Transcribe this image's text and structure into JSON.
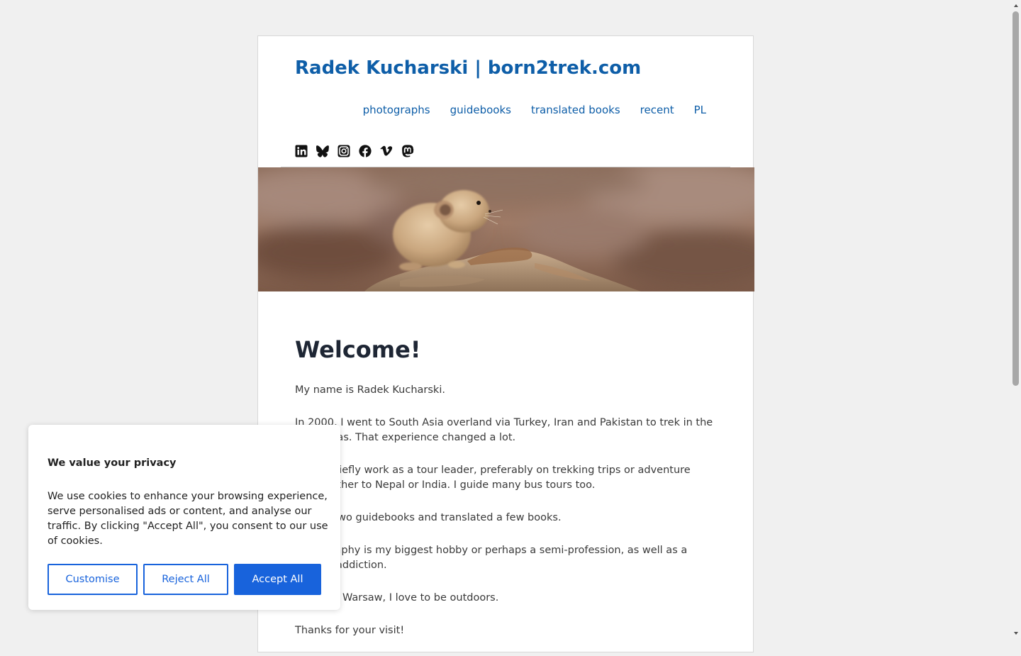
{
  "site": {
    "title": "Radek Kucharski | born2trek.com"
  },
  "nav": {
    "items": [
      "photographs",
      "guidebooks",
      "translated books",
      "recent",
      "PL"
    ]
  },
  "social": {
    "icons": [
      "linkedin-icon",
      "bluesky-icon",
      "instagram-icon",
      "facebook-icon",
      "vimeo-icon",
      "mastodon-icon"
    ]
  },
  "hero": {
    "alt": "Pika sitting on a rock"
  },
  "main": {
    "heading": "Welcome!",
    "paragraphs": [
      "My name is Radek Kucharski.",
      "In 2000, I went to South Asia overland via Turkey, Iran and Pakistan to trek in the Himalayas. That experience changed a lot.",
      "Now I chiefly work as a tour leader, preferably on trekking trips or adventure tours, either to Nepal or India. I guide many bus tours too.",
      "I wrote two guidebooks and translated a few books.",
      "Photography is my biggest hobby or perhaps a semi-profession, as well as a lifelong addiction.",
      "Based in Warsaw, I love to be outdoors.",
      "Thanks for your visit!"
    ]
  },
  "cookie": {
    "title": "We value your privacy",
    "text": "We use cookies to enhance your browsing experience, serve personalised ads or content, and analyse our traffic. By clicking \"Accept All\", you consent to our use of cookies.",
    "customise": "Customise",
    "reject": "Reject All",
    "accept": "Accept All"
  },
  "colors": {
    "link": "#0e5ea8",
    "heading": "#1e2634",
    "button": "#1863dc",
    "background": "#f0f0f0"
  }
}
